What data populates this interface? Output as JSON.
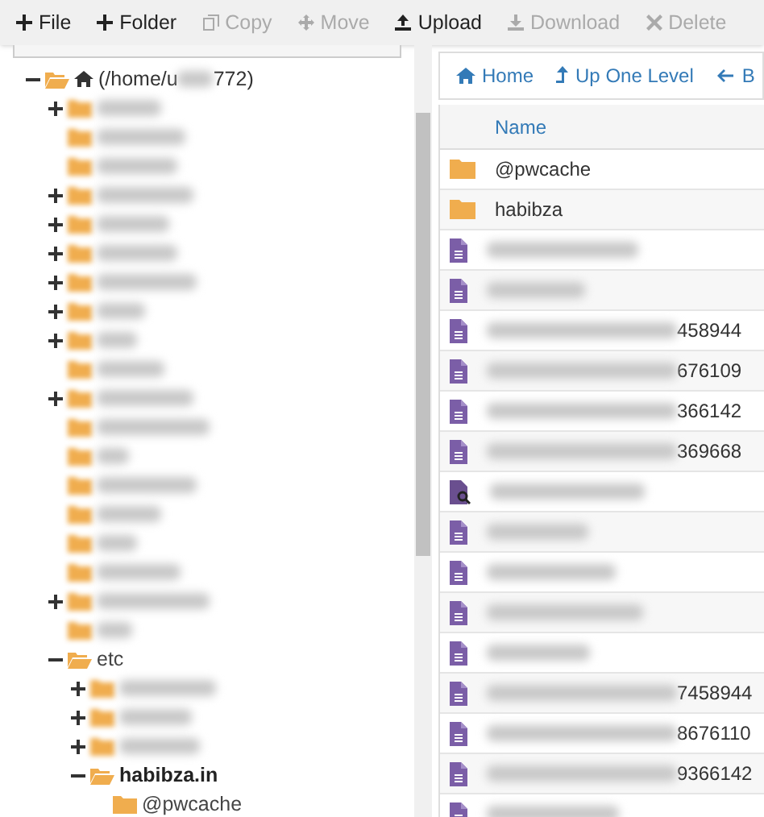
{
  "toolbar": [
    {
      "label": "File",
      "disabled": false
    },
    {
      "label": "Folder",
      "disabled": false
    },
    {
      "label": "Copy",
      "disabled": true
    },
    {
      "label": "Move",
      "disabled": true
    },
    {
      "label": "Upload",
      "disabled": false
    },
    {
      "label": "Download",
      "disabled": true
    },
    {
      "label": "Delete",
      "disabled": true
    }
  ],
  "tree": {
    "label_start": "(/home/u",
    "label_end": "772)",
    "redacted": true,
    "expanded": true,
    "children": [
      {
        "redacted": true,
        "expanded": false
      },
      {
        "redacted": true
      },
      {
        "redacted": true
      },
      {
        "redacted": true,
        "expanded": false
      },
      {
        "redacted": true,
        "expanded": false
      },
      {
        "redacted": true,
        "expanded": false
      },
      {
        "redacted": true,
        "expanded": false
      },
      {
        "redacted": true,
        "expanded": false
      },
      {
        "redacted": true,
        "expanded": false
      },
      {
        "redacted": true
      },
      {
        "redacted": true,
        "expanded": false
      },
      {
        "redacted": true
      },
      {
        "redacted": true
      },
      {
        "redacted": true
      },
      {
        "redacted": true
      },
      {
        "redacted": true
      },
      {
        "redacted": true
      },
      {
        "redacted": true,
        "expanded": false
      },
      {
        "redacted": true
      },
      {
        "name": "etc",
        "redacted": false,
        "expanded": true,
        "children": [
          {
            "redacted": true,
            "expanded": false
          },
          {
            "redacted": true,
            "expanded": false
          },
          {
            "redacted": true,
            "expanded": false
          },
          {
            "name": "habibza.in",
            "redacted": false,
            "expanded": true,
            "selected": true,
            "children": [
              {
                "name": "@pwcache",
                "redacted": false,
                "selected": false
              }
            ]
          }
        ]
      }
    ]
  },
  "nav": [
    {
      "label": "Home"
    },
    {
      "label": "Up One Level"
    },
    {
      "label": "B"
    }
  ],
  "table": {
    "columns": [
      "Name"
    ],
    "rows": [
      {
        "kind": "folder",
        "name": "@pwcache",
        "redacted": false
      },
      {
        "kind": "folder",
        "name": "habibza",
        "redacted": false
      },
      {
        "kind": "file",
        "redacted": true
      },
      {
        "kind": "file",
        "redacted": true
      },
      {
        "kind": "file",
        "redacted": true,
        "name": "458944"
      },
      {
        "kind": "file",
        "redacted": true,
        "name": "676109"
      },
      {
        "kind": "file",
        "redacted": true,
        "name": "366142"
      },
      {
        "kind": "file",
        "redacted": true,
        "name": "369668"
      },
      {
        "kind": "search-file",
        "redacted": true
      },
      {
        "kind": "file",
        "redacted": true
      },
      {
        "kind": "file",
        "redacted": true
      },
      {
        "kind": "file",
        "redacted": true
      },
      {
        "kind": "file",
        "redacted": true
      },
      {
        "kind": "file",
        "redacted": true,
        "name": "7458944"
      },
      {
        "kind": "file",
        "redacted": true,
        "name": "8676110"
      },
      {
        "kind": "file",
        "redacted": true,
        "name": "9366142"
      },
      {
        "kind": "file",
        "redacted": true
      }
    ]
  }
}
